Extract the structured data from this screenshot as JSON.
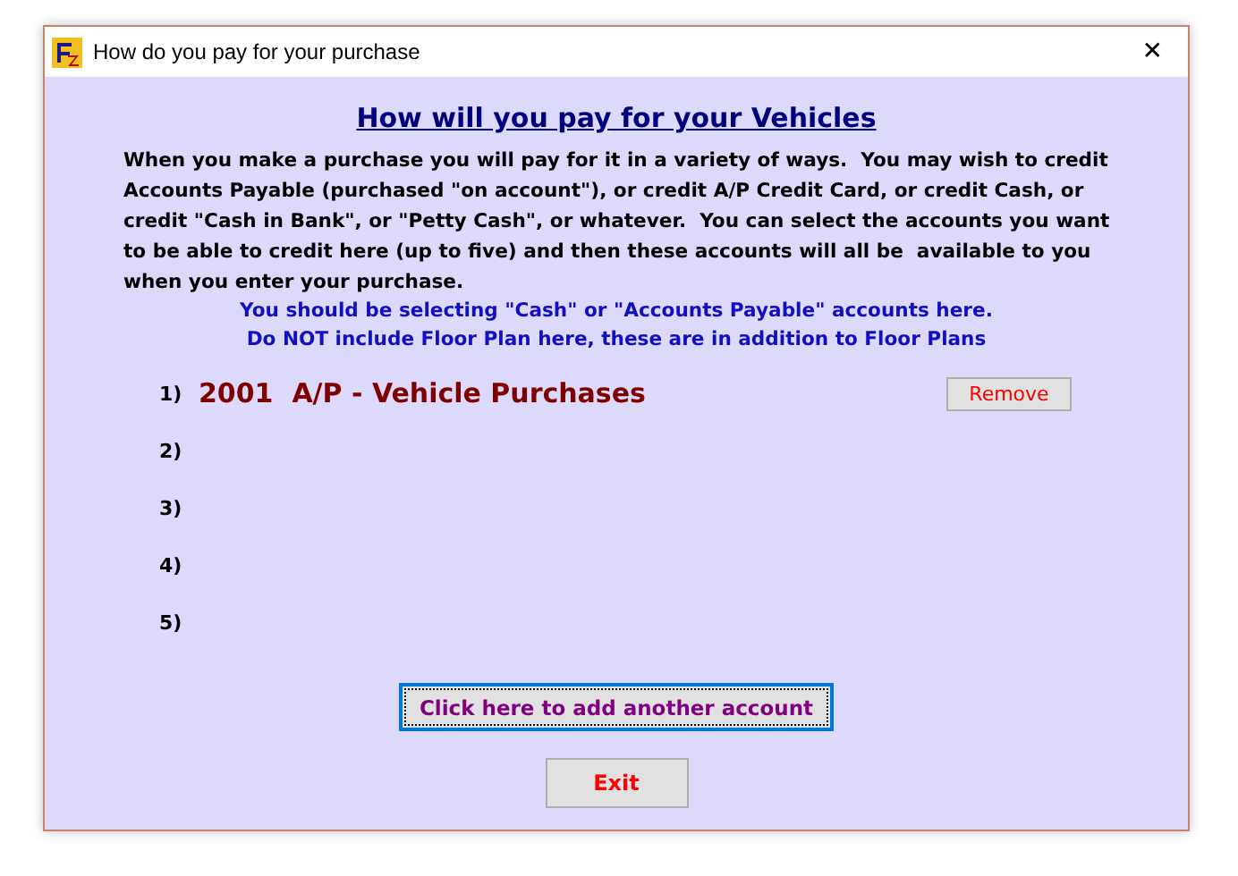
{
  "window": {
    "title": "How do you pay for your purchase",
    "close": "✕"
  },
  "heading": "How will you pay for your Vehicles",
  "intro": "When you make a purchase you will pay for it in a variety of ways.  You may wish to credit Accounts Payable (purchased \"on account\"), or credit A/P Credit Card, or credit Cash, or credit \"Cash in Bank\", or \"Petty Cash\", or whatever.  You can select the accounts you want to be able to credit here (up to five) and then these accounts will all be  available to you when you enter your purchase.",
  "notes": [
    "You should be selecting \"Cash\" or \"Accounts Payable\" accounts here.",
    "Do NOT include Floor Plan here, these are in addition to Floor Plans"
  ],
  "accounts": [
    {
      "number": "1)",
      "account": "2001  A/P - Vehicle Purchases",
      "remove": "Remove"
    },
    {
      "number": "2)"
    },
    {
      "number": "3)"
    },
    {
      "number": "4)"
    },
    {
      "number": "5)"
    }
  ],
  "add_button": "Click here to add another account",
  "exit_button": "Exit"
}
